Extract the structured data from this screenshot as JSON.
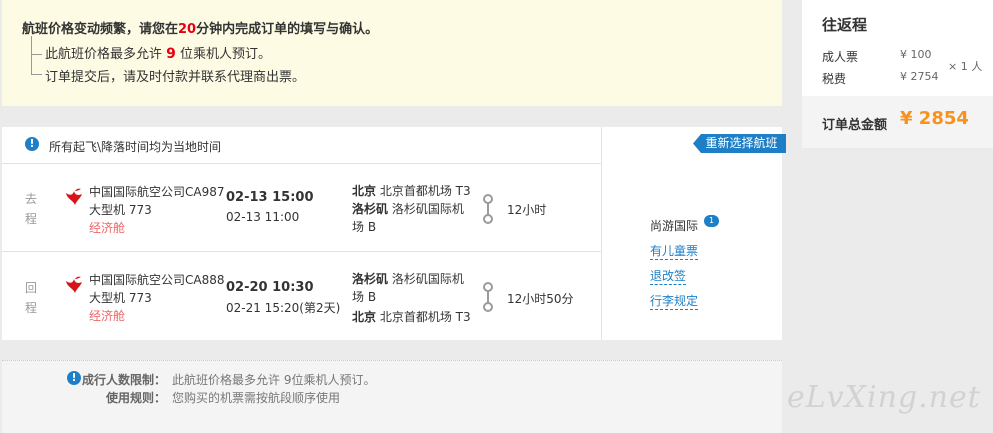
{
  "notice": {
    "title_pre": "航班价格变动频繁，请您在",
    "title_minutes": "20",
    "title_post": "分钟内完成订单的填写与确认。",
    "item1_pre": "此航班价格最多允许 ",
    "item1_num": "9",
    "item1_post": " 位乘机人预订。",
    "item2": "订单提交后，请及时付款并联系代理商出票。"
  },
  "price": {
    "title": "往返程",
    "adult_label": "成人票",
    "adult_value": "¥ 100",
    "tax_label": "税费",
    "tax_value": "¥ 2754",
    "multiplier": "× 1 人",
    "total_label": "订单总金额",
    "total_value": "¥ 2854"
  },
  "flights": {
    "info_icon": "!",
    "info_text": "所有起飞\\降落时间均为当地时间",
    "reselect_label": "重新选择航班",
    "segments": [
      {
        "tag": "去程",
        "airline": "中国国际航空公司CA987",
        "plane": "大型机 773",
        "cabin": "经济舱",
        "dep_time": "02-13 15:00",
        "arr_time": "02-13 11:00",
        "dep_city": "北京",
        "dep_airport": "北京首都机场 T3",
        "arr_city": "洛杉矶",
        "arr_airport": "洛杉矶国际机场 B",
        "duration": "12小时"
      },
      {
        "tag": "回程",
        "airline": "中国国际航空公司CA888",
        "plane": "大型机 773",
        "cabin": "经济舱",
        "dep_time": "02-20 10:30",
        "arr_time": "02-21 15:20(第2天)",
        "dep_city": "洛杉矶",
        "dep_airport": "洛杉矶国际机场 B",
        "arr_city": "北京",
        "arr_airport": "北京首都机场 T3",
        "duration": "12小时50分"
      }
    ],
    "agent": "尚游国际",
    "agent_badge": "1",
    "links": [
      "有儿童票",
      "退改签",
      "行李规定"
    ]
  },
  "restrictions": {
    "icon": "!",
    "limit_label": "成行人数限制：",
    "limit_value": "此航班价格最多允许 9位乘机人预订。",
    "rule_label": "使用规则：",
    "rule_value": "您购买的机票需按航段顺序使用"
  },
  "watermark": "eLvXing.net",
  "colors": {
    "accent": "#1e7fc7",
    "price": "#f7921e",
    "warning": "#e60012"
  }
}
